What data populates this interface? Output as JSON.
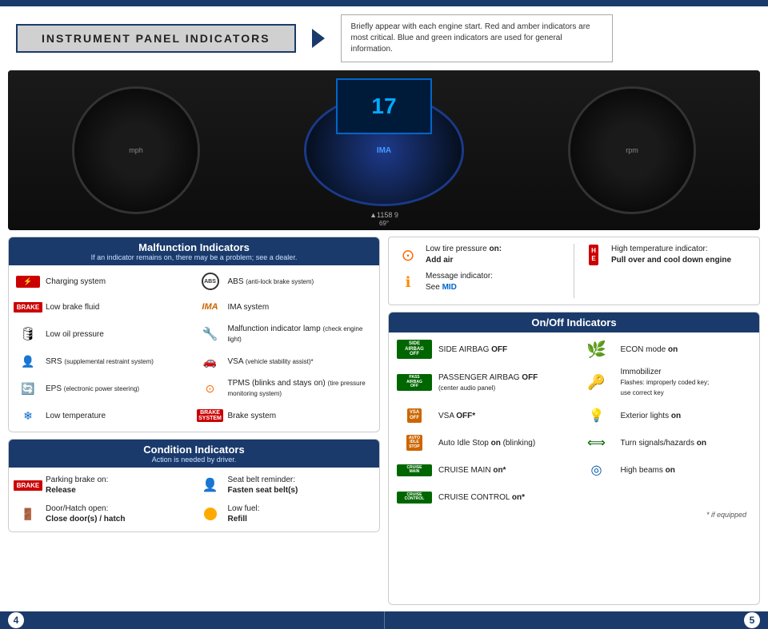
{
  "page": {
    "title": "INSTRUMENT PANEL INDICATORS",
    "header_note": "Briefly appear with each engine start. Red and amber indicators are most critical. Blue and green indicators are used for general information.",
    "page_left": "4",
    "page_right": "5",
    "dashboard_display": "17",
    "footnote": "* if equipped"
  },
  "malfunction": {
    "section_title": "Malfunction Indicators",
    "section_subtitle": "If an indicator remains on, there may be a problem; see a dealer.",
    "items_left": [
      {
        "id": "charging",
        "label": "Charging system"
      },
      {
        "id": "low-brake",
        "label": "Low brake fluid"
      },
      {
        "id": "low-oil",
        "label": "Low oil pressure"
      },
      {
        "id": "srs",
        "label": "SRS (supplemental restraint system)"
      },
      {
        "id": "eps",
        "label": "EPS (electronic power steering)"
      },
      {
        "id": "low-temp",
        "label": "Low temperature"
      }
    ],
    "items_right": [
      {
        "id": "abs",
        "label": "ABS (anti-lock brake system)"
      },
      {
        "id": "ima",
        "label": "IMA system"
      },
      {
        "id": "mil",
        "label": "Malfunction indicator lamp (check engine light)"
      },
      {
        "id": "vsa",
        "label": "VSA (vehicle stability assist)*"
      },
      {
        "id": "tpms",
        "label": "TPMS (blinks and stays on) (tire pressure monitoring system)"
      },
      {
        "id": "brake-sys",
        "label": "Brake system"
      }
    ]
  },
  "condition": {
    "section_title": "Condition Indicators",
    "section_subtitle": "Action is needed by driver.",
    "items_left": [
      {
        "id": "parking-brake",
        "label": "Parking brake on:",
        "bold": "Release"
      },
      {
        "id": "door-open",
        "label": "Door/Hatch open:",
        "bold": "Close door(s) / hatch"
      }
    ],
    "items_right": [
      {
        "id": "seatbelt",
        "label": "Seat belt reminder:",
        "bold": "Fasten seat belt(s)"
      },
      {
        "id": "low-fuel",
        "label": "Low fuel:",
        "bold": "Refill"
      }
    ]
  },
  "alerts": {
    "items": [
      {
        "id": "tire-pressure",
        "label_pre": "Low tire pressure ",
        "label_bold": "on:",
        "label_post": "\nAdd air"
      },
      {
        "id": "message-ind",
        "label_pre": "Message indicator:\nSee ",
        "label_bold": "MID"
      }
    ],
    "items_right": [
      {
        "id": "high-temp",
        "label_pre": "High temperature indicator:",
        "label_bold": "\nPull over and cool down engine"
      }
    ]
  },
  "onoff": {
    "section_title": "On/Off Indicators",
    "items_left": [
      {
        "id": "side-airbag",
        "label_pre": "SIDE AIRBAG ",
        "label_bold": "OFF"
      },
      {
        "id": "pass-airbag",
        "label_pre": "PASSENGER AIRBAG ",
        "label_bold": "OFF",
        "label_sub": "(center audio panel)"
      },
      {
        "id": "vsa-off",
        "label_pre": "VSA ",
        "label_bold": "OFF*"
      },
      {
        "id": "auto-idle",
        "label_pre": "Auto Idle Stop ",
        "label_bold": "on",
        "label_sub": "(blinking)"
      },
      {
        "id": "cruise-main",
        "label_pre": "CRUISE MAIN ",
        "label_bold": "on*"
      },
      {
        "id": "cruise-control",
        "label_pre": "CRUISE CONTROL ",
        "label_bold": "on*"
      }
    ],
    "items_right": [
      {
        "id": "econ",
        "label_pre": "ECON mode ",
        "label_bold": "on"
      },
      {
        "id": "immob",
        "label_pre": "Immobilizer",
        "label_sub": "Flashes: improperly coded key; use correct key"
      },
      {
        "id": "ext-lights",
        "label_pre": "Exterior lights ",
        "label_bold": "on"
      },
      {
        "id": "turn-signals",
        "label_pre": "Turn signals/hazards ",
        "label_bold": "on"
      },
      {
        "id": "high-beams",
        "label_pre": "High beams ",
        "label_bold": "on"
      }
    ]
  }
}
